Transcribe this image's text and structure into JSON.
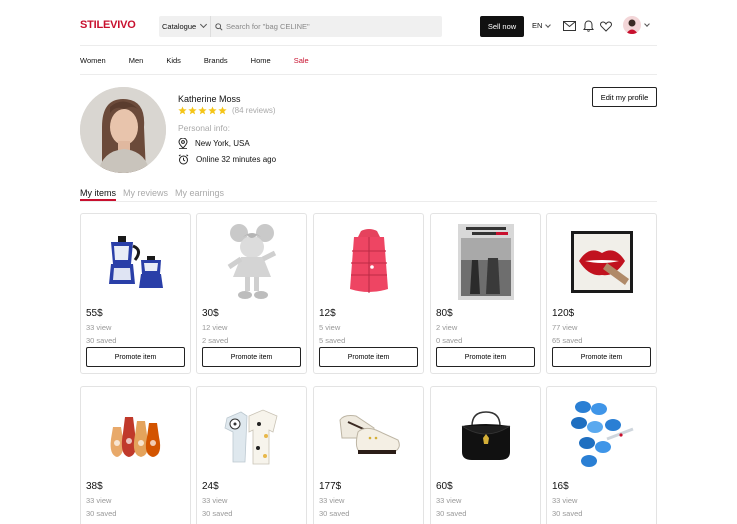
{
  "header": {
    "logo": "STILEVIVO",
    "catalogue_label": "Catalogue",
    "search_placeholder": "Search for \"bag CELINE\"",
    "sell_label": "Sell now",
    "language": "EN"
  },
  "nav": {
    "items": [
      "Women",
      "Men",
      "Kids",
      "Brands",
      "Home",
      "Sale"
    ]
  },
  "profile": {
    "name": "Katherine Moss",
    "rating_stars": 5,
    "reviews": "(84 reviews)",
    "personal_info_label": "Personal info:",
    "location": "New York, USA",
    "online_status": "Online 32 minutes ago",
    "edit_label": "Edit my profile"
  },
  "tabs": [
    "My items",
    "My reviews",
    "My earnings"
  ],
  "items": [
    {
      "price": "55$",
      "views": "33 view",
      "saved": "30 saved",
      "promote": "Promote item",
      "icon": "moka-pot-icon"
    },
    {
      "price": "30$",
      "views": "12 view",
      "saved": "2 saved",
      "promote": "Promote item",
      "icon": "minnie-statue-icon"
    },
    {
      "price": "12$",
      "views": "5 view",
      "saved": "5 saved",
      "promote": "Promote item",
      "icon": "pink-puffer-vest-icon"
    },
    {
      "price": "80$",
      "views": "2 view",
      "saved": "0 saved",
      "promote": "Promote item",
      "icon": "doisneau-book-icon"
    },
    {
      "price": "120$",
      "views": "77 view",
      "saved": "65 saved",
      "promote": "Promote item",
      "icon": "lips-artwork-icon"
    },
    {
      "price": "38$",
      "views": "33 view",
      "saved": "30 saved",
      "promote": "",
      "icon": "vases-icon"
    },
    {
      "price": "24$",
      "views": "33 view",
      "saved": "30 saved",
      "promote": "",
      "icon": "baby-onesie-icon"
    },
    {
      "price": "177$",
      "views": "33 view",
      "saved": "30 saved",
      "promote": "",
      "icon": "baby-sneakers-icon"
    },
    {
      "price": "60$",
      "views": "33 view",
      "saved": "30 saved",
      "promote": "",
      "icon": "black-bag-icon"
    },
    {
      "price": "16$",
      "views": "33 view",
      "saved": "30 saved",
      "promote": "",
      "icon": "blue-cups-icon"
    }
  ],
  "colors": {
    "brand": "#c8102e",
    "star": "#f5c518",
    "muted": "#999999"
  }
}
